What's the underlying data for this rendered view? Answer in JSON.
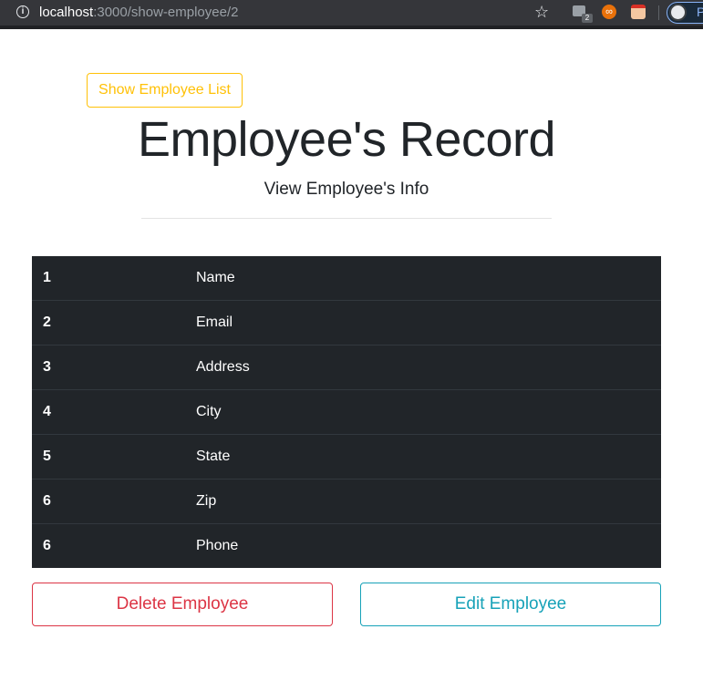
{
  "browser": {
    "url_host": "localhost",
    "url_rest": ":3000/show-employee/2",
    "profile_initial": "P",
    "mail_badge": "2"
  },
  "page": {
    "show_list_label": "Show Employee List",
    "title": "Employee's Record",
    "subtitle": "View Employee's Info"
  },
  "table": {
    "rows": [
      {
        "num": "1",
        "label": "Name"
      },
      {
        "num": "2",
        "label": "Email"
      },
      {
        "num": "3",
        "label": "Address"
      },
      {
        "num": "4",
        "label": "City"
      },
      {
        "num": "5",
        "label": "State"
      },
      {
        "num": "6",
        "label": "Zip"
      },
      {
        "num": "6",
        "label": "Phone"
      }
    ]
  },
  "actions": {
    "delete_label": "Delete Employee",
    "edit_label": "Edit Employee"
  },
  "colors": {
    "warning": "#ffc107",
    "danger": "#dc3545",
    "info": "#17a2b8",
    "table_bg": "#212529"
  }
}
